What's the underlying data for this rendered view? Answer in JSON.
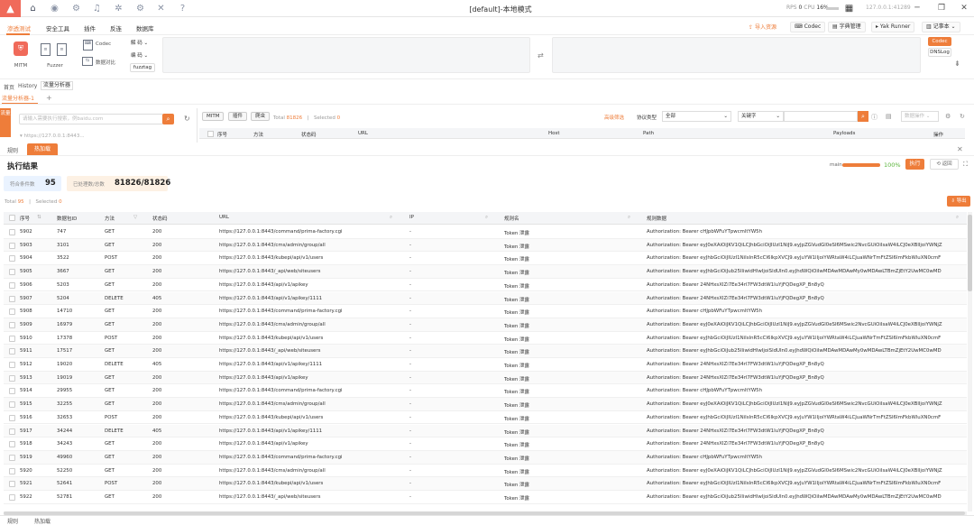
{
  "window": {
    "title": "[default]-本地模式",
    "rps_label": "RPS",
    "rps_value": "0",
    "cpu_label": "CPU",
    "cpu_value": "16%",
    "address": "127.0.0.1:41289"
  },
  "menu": {
    "items": [
      "渗透测试",
      "安全工具",
      "插件",
      "反连",
      "数据库"
    ]
  },
  "right_buttons": {
    "import": "导入资源",
    "codec": "Codec",
    "dict": "字典管理",
    "yak_runner": "Yak Runner",
    "notebook": "记事本"
  },
  "tools": {
    "mitm": "MITM",
    "fuzzer": "Fuzzer",
    "codec": "Codec",
    "data_compare": "数据对比",
    "decode": "解 码",
    "encode": "编 码",
    "fuzztag": "fuzztag",
    "codec_btn": "Codec",
    "dnslog": "DNSLog"
  },
  "tabs": {
    "items": [
      "首页",
      "History",
      "流量分析器"
    ],
    "active": "流量分析器",
    "subtab": "流量分析器-1"
  },
  "left_strip": "流量",
  "left_search": {
    "placeholder": "请输入需要执行搜索，例baidu.com"
  },
  "filter": {
    "pills": [
      "MITM",
      "插件",
      "爬虫"
    ],
    "total_label": "Total",
    "total": "81826",
    "selected_label": "Selected",
    "selected": "0",
    "advanced": "高级筛选",
    "protocol_label": "协议类型",
    "protocol_value": "全部",
    "keyword": "关键字",
    "data_ops": "数据操作"
  },
  "header_a": [
    "序号",
    "方法",
    "状态码",
    "URL",
    "Host",
    "Path",
    "Payloads",
    "操作"
  ],
  "panel2": {
    "rule_tab": "规则",
    "hotpatch_tab": "热加载",
    "title": "执行结果",
    "main_label": "main",
    "progress": "100%",
    "progress_fraction": 1.0,
    "run_btn": "执行",
    "back_btn": "返回"
  },
  "cards": {
    "matched_label": "符合条件数",
    "matched": "95",
    "processed_label": "已处理数/总数",
    "processed": "81826/81826"
  },
  "result_totals": {
    "total_label": "Total",
    "total": "95",
    "selected_label": "Selected",
    "selected": "0",
    "export": "导出"
  },
  "columns": [
    "序号",
    "数据包ID",
    "方法",
    "状态码",
    "URL",
    "IP",
    "规则名",
    "规则数据"
  ],
  "rows": [
    [
      "5902",
      "747",
      "GET",
      "200",
      "https://127.0.0.1:8443/command/prima-factory.cgi",
      "-",
      "Token 泄露",
      "Authorization: Bearer cHJpbWFuYTpwcmltYW5h"
    ],
    [
      "5903",
      "3101",
      "GET",
      "200",
      "https://127.0.0.1:8443/cms/admin/group/all",
      "-",
      "Token 泄露",
      "Authorization: Bearer eyJ0eXAiOiJKV1QiLCJhbGciOiJIUzI1NiJ9.eyJpZGVudGl0eSI6MSwic2NvcGUiOiIsaW4iLCJ0eXBlIjoiYWNjZ"
    ],
    [
      "5904",
      "3522",
      "POST",
      "200",
      "https://127.0.0.1:8443/kubepi/api/v1/users",
      "-",
      "Token 泄露",
      "Authorization: Bearer eyJhbGciOiJIUzI1NiIsInR5cCI6IkpXVCJ9.eyJuYW1lIjoiYWRtaW4iLCJuaWNrTmFtZSI6ImFkbWluXN0cmF"
    ],
    [
      "5905",
      "3667",
      "GET",
      "200",
      "https://127.0.0.1:8443/_api/web/siteusers",
      "-",
      "Token 泄露",
      "Authorization: Bearer eyJhbGciOiJub25lIiwidHlwIjoiSldUIn0.eyJhdWQiOiIwMDAwMDAwMy0wMDAwLTBmZjEtY2UwMC0wMD"
    ],
    [
      "5906",
      "5203",
      "GET",
      "200",
      "https://127.0.0.1:8443/api/v1/apikey",
      "-",
      "Token 泄露",
      "Authorization: Bearer 24NHxsXIZi7Ee34rI7FW3dtW1IuYjFQDegXP_Bn8yQ"
    ],
    [
      "5907",
      "5204",
      "DELETE",
      "405",
      "https://127.0.0.1:8443/api/v1/apikey/1111",
      "-",
      "Token 泄露",
      "Authorization: Bearer 24NHxsXIZi7Ee34rI7FW3dtW1IuYjFQDegXP_Bn8yQ"
    ],
    [
      "5908",
      "14710",
      "GET",
      "200",
      "https://127.0.0.1:8443/command/prima-factory.cgi",
      "-",
      "Token 泄露",
      "Authorization: Bearer cHJpbWFuYTpwcmltYW5h"
    ],
    [
      "5909",
      "16979",
      "GET",
      "200",
      "https://127.0.0.1:8443/cms/admin/group/all",
      "-",
      "Token 泄露",
      "Authorization: Bearer eyJ0eXAiOiJKV1QiLCJhbGciOiJIUzI1NiJ9.eyJpZGVudGl0eSI6MSwic2NvcGUiOiIsaW4iLCJ0eXBlIjoiYWNjZ"
    ],
    [
      "5910",
      "17378",
      "POST",
      "200",
      "https://127.0.0.1:8443/kubepi/api/v1/users",
      "-",
      "Token 泄露",
      "Authorization: Bearer eyJhbGciOiJIUzI1NiIsInR5cCI6IkpXVCJ9.eyJuYW1lIjoiYWRtaW4iLCJuaWNrTmFtZSI6ImFkbWluXN0cmF"
    ],
    [
      "5911",
      "17517",
      "GET",
      "200",
      "https://127.0.0.1:8443/_api/web/siteusers",
      "-",
      "Token 泄露",
      "Authorization: Bearer eyJhbGciOiJub25lIiwidHlwIjoiSldUIn0.eyJhdWQiOiIwMDAwMDAwMy0wMDAwLTBmZjEtY2UwMC0wMD"
    ],
    [
      "5912",
      "19020",
      "DELETE",
      "405",
      "https://127.0.0.1:8443/api/v1/apikey/1111",
      "-",
      "Token 泄露",
      "Authorization: Bearer 24NHxsXIZi7Ee34rI7FW3dtW1IuYjFQDegXP_Bn8yQ"
    ],
    [
      "5913",
      "19019",
      "GET",
      "200",
      "https://127.0.0.1:8443/api/v1/apikey",
      "-",
      "Token 泄露",
      "Authorization: Bearer 24NHxsXIZi7Ee34rI7FW3dtW1IuYjFQDegXP_Bn8yQ"
    ],
    [
      "5914",
      "29955",
      "GET",
      "200",
      "https://127.0.0.1:8443/command/prima-factory.cgi",
      "-",
      "Token 泄露",
      "Authorization: Bearer cHJpbWFuYTpwcmltYW5h"
    ],
    [
      "5915",
      "32255",
      "GET",
      "200",
      "https://127.0.0.1:8443/cms/admin/group/all",
      "-",
      "Token 泄露",
      "Authorization: Bearer eyJ0eXAiOiJKV1QiLCJhbGciOiJIUzI1NiJ9.eyJpZGVudGl0eSI6MSwic2NvcGUiOiIsaW4iLCJ0eXBlIjoiYWNjZ"
    ],
    [
      "5916",
      "32653",
      "POST",
      "200",
      "https://127.0.0.1:8443/kubepi/api/v1/users",
      "-",
      "Token 泄露",
      "Authorization: Bearer eyJhbGciOiJIUzI1NiIsInR5cCI6IkpXVCJ9.eyJuYW1lIjoiYWRtaW4iLCJuaWNrTmFtZSI6ImFkbWluXN0cmF"
    ],
    [
      "5917",
      "34244",
      "DELETE",
      "405",
      "https://127.0.0.1:8443/api/v1/apikey/1111",
      "-",
      "Token 泄露",
      "Authorization: Bearer 24NHxsXIZi7Ee34rI7FW3dtW1IuYjFQDegXP_Bn8yQ"
    ],
    [
      "5918",
      "34243",
      "GET",
      "200",
      "https://127.0.0.1:8443/api/v1/apikey",
      "-",
      "Token 泄露",
      "Authorization: Bearer 24NHxsXIZi7Ee34rI7FW3dtW1IuYjFQDegXP_Bn8yQ"
    ],
    [
      "5919",
      "49960",
      "GET",
      "200",
      "https://127.0.0.1:8443/command/prima-factory.cgi",
      "-",
      "Token 泄露",
      "Authorization: Bearer cHJpbWFuYTpwcmltYW5h"
    ],
    [
      "5920",
      "52250",
      "GET",
      "200",
      "https://127.0.0.1:8443/cms/admin/group/all",
      "-",
      "Token 泄露",
      "Authorization: Bearer eyJ0eXAiOiJKV1QiLCJhbGciOiJIUzI1NiJ9.eyJpZGVudGl0eSI6MSwic2NvcGUiOiIsaW4iLCJ0eXBlIjoiYWNjZ"
    ],
    [
      "5921",
      "52641",
      "POST",
      "200",
      "https://127.0.0.1:8443/kubepi/api/v1/users",
      "-",
      "Token 泄露",
      "Authorization: Bearer eyJhbGciOiJIUzI1NiIsInR5cCI6IkpXVCJ9.eyJuYW1lIjoiYWRtaW4iLCJuaWNrTmFtZSI6ImFkbWluXN0cmF"
    ],
    [
      "5922",
      "52781",
      "GET",
      "200",
      "https://127.0.0.1:8443/_api/web/siteusers",
      "-",
      "Token 泄露",
      "Authorization: Bearer eyJhbGciOiJub25lIiwidHlwIjoiSldUIn0.eyJhdWQiOiIwMDAwMDAwMy0wMDAwLTBmZjEtY2UwMC0wMD"
    ]
  ],
  "bottom_tabs": [
    "规则",
    "热加载"
  ],
  "colors": {
    "accent": "#ee7d3a",
    "logo": "#f06a5a",
    "progress_text": "#5ab43a"
  }
}
